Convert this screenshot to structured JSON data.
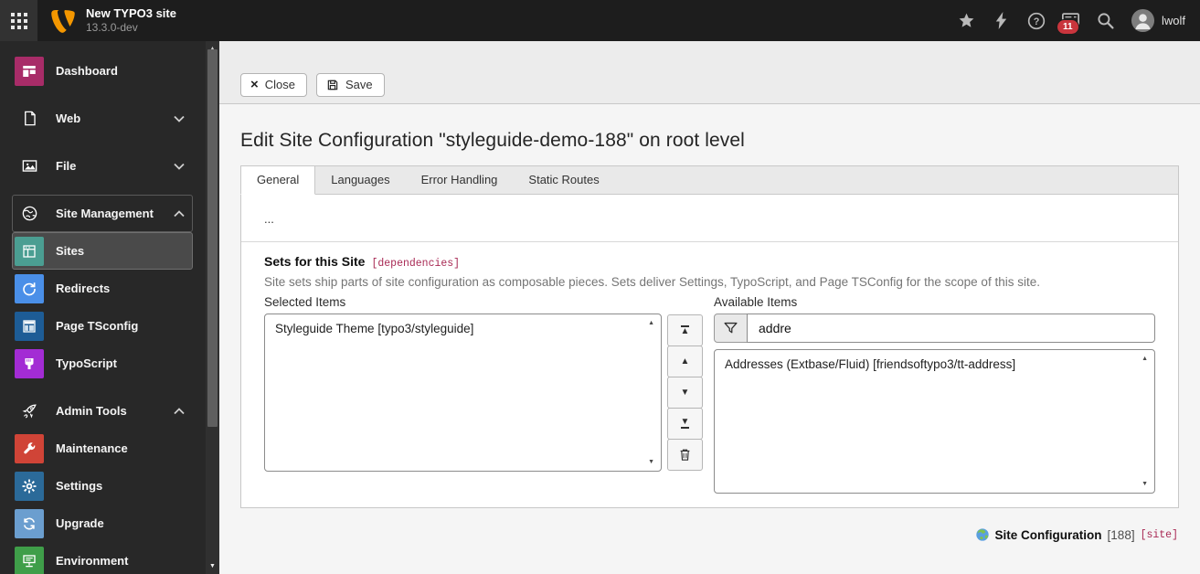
{
  "topbar": {
    "title": "New TYPO3 site",
    "version": "13.3.0-dev",
    "notification_count": "11",
    "username": "lwolf"
  },
  "sidebar": {
    "items": [
      {
        "label": "Dashboard",
        "color": "#a82c68",
        "kind": "module"
      },
      {
        "label": "Web",
        "kind": "group-collapsed"
      },
      {
        "label": "File",
        "kind": "group-collapsed"
      },
      {
        "label": "Site Management",
        "kind": "group-expanded"
      },
      {
        "label": "Sites",
        "color": "#4b9e92",
        "kind": "module",
        "active": true
      },
      {
        "label": "Redirects",
        "color": "#4a8fe8",
        "kind": "module"
      },
      {
        "label": "Page TSconfig",
        "color": "#1d5c96",
        "kind": "module"
      },
      {
        "label": "TypoScript",
        "color": "#a32cd4",
        "kind": "module"
      },
      {
        "label": "Admin Tools",
        "kind": "group-expanded"
      },
      {
        "label": "Maintenance",
        "color": "#d04437",
        "kind": "module"
      },
      {
        "label": "Settings",
        "color": "#2b6a99",
        "kind": "module"
      },
      {
        "label": "Upgrade",
        "color": "#6b9ecf",
        "kind": "module"
      },
      {
        "label": "Environment",
        "color": "#3f9e49",
        "kind": "module"
      }
    ]
  },
  "docheader": {
    "close_label": "Close",
    "save_label": "Save"
  },
  "main": {
    "title": "Edit Site Configuration \"styleguide-demo-188\" on root level",
    "tabs": [
      {
        "label": "General",
        "active": true
      },
      {
        "label": "Languages"
      },
      {
        "label": "Error Handling"
      },
      {
        "label": "Static Routes"
      }
    ],
    "palette_placeholder": "...",
    "sets": {
      "legend": "Sets for this Site",
      "legend_note": "[dependencies]",
      "description": "Site sets ship parts of site configuration as composable pieces. Sets deliver Settings, TypoScript, and Page TSConfig for the scope of this site.",
      "selected_label": "Selected Items",
      "available_label": "Available Items",
      "selected_items": [
        "Styleguide Theme [typo3/styleguide]"
      ],
      "filter_value": "addre",
      "available_items": [
        "Addresses (Extbase/Fluid) [friendsoftypo3/tt-address]"
      ]
    },
    "footer": {
      "record_title": "Site Configuration",
      "record_uid": "[188]",
      "record_table": "[site]"
    }
  },
  "icons": {
    "close_glyph": "×",
    "move_to_top": "▲",
    "move_up": "▲",
    "move_down": "▼",
    "move_to_bottom": "▼",
    "scroll_up": "▲",
    "scroll_down": "▼"
  },
  "colors": {
    "accent_note": "#a82954",
    "badge_red": "#c9353d",
    "logo_orange": "#f49700",
    "topbar_bg": "#1d1d1d",
    "sidebar_bg": "#282828"
  }
}
